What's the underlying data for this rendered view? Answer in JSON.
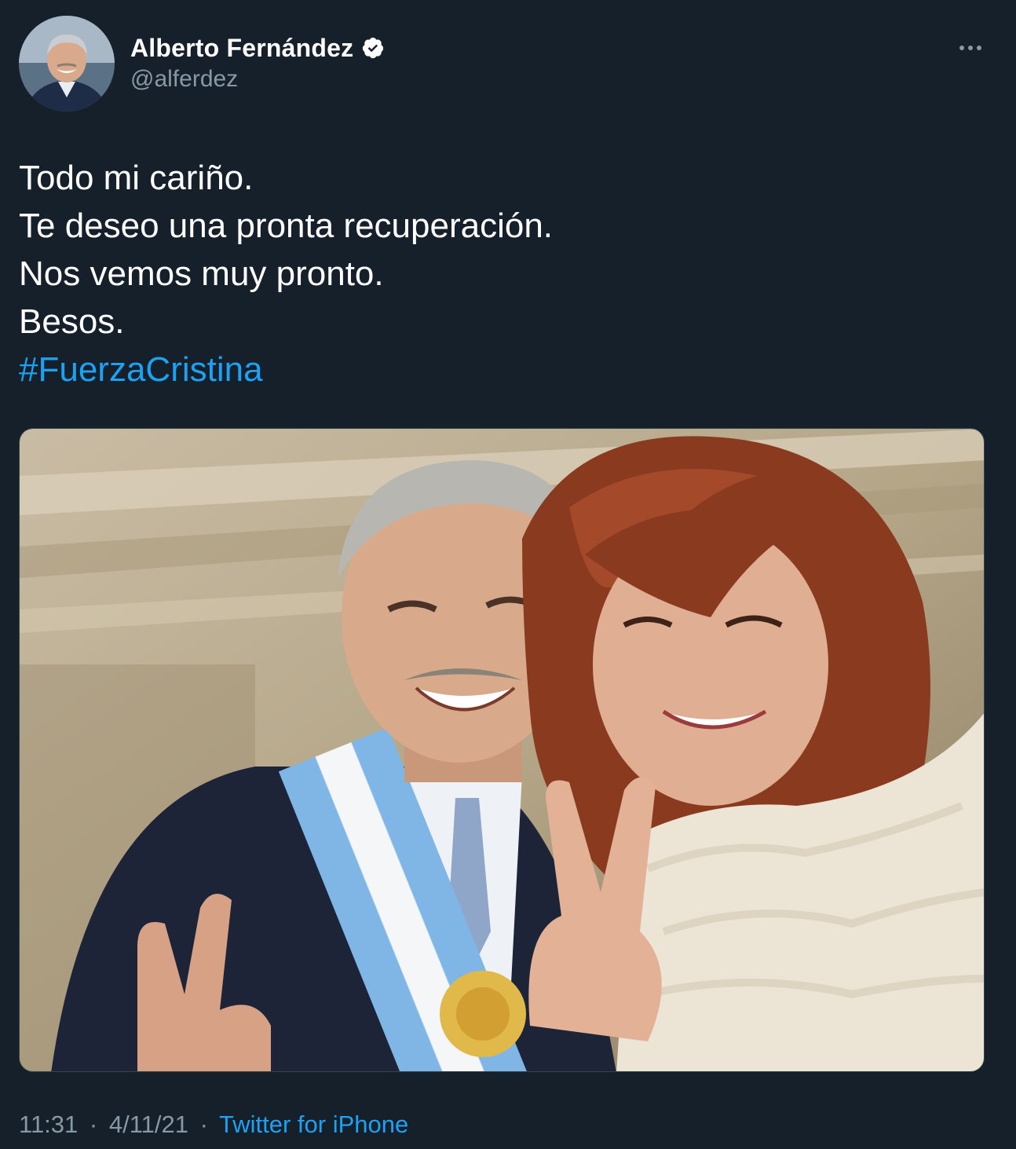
{
  "colors": {
    "background": "#15202b",
    "text_primary": "#ffffff",
    "text_secondary": "#8899a6",
    "accent": "#1da1f2"
  },
  "author": {
    "display_name": "Alberto Fernández",
    "handle": "@alferdez",
    "verified_icon": "verified-badge-icon",
    "avatar_icon": "profile-avatar"
  },
  "more_icon": "more-options-icon",
  "tweet": {
    "lines": [
      "Todo mi cariño.",
      "Te deseo una pronta recuperación.",
      "Nos vemos muy pronto.",
      "Besos."
    ],
    "hashtag": "#FuerzaCristina"
  },
  "media": {
    "kind": "photo"
  },
  "meta": {
    "time": "11:31",
    "date": "4/11/21",
    "separator": "·",
    "source": "Twitter for iPhone"
  }
}
